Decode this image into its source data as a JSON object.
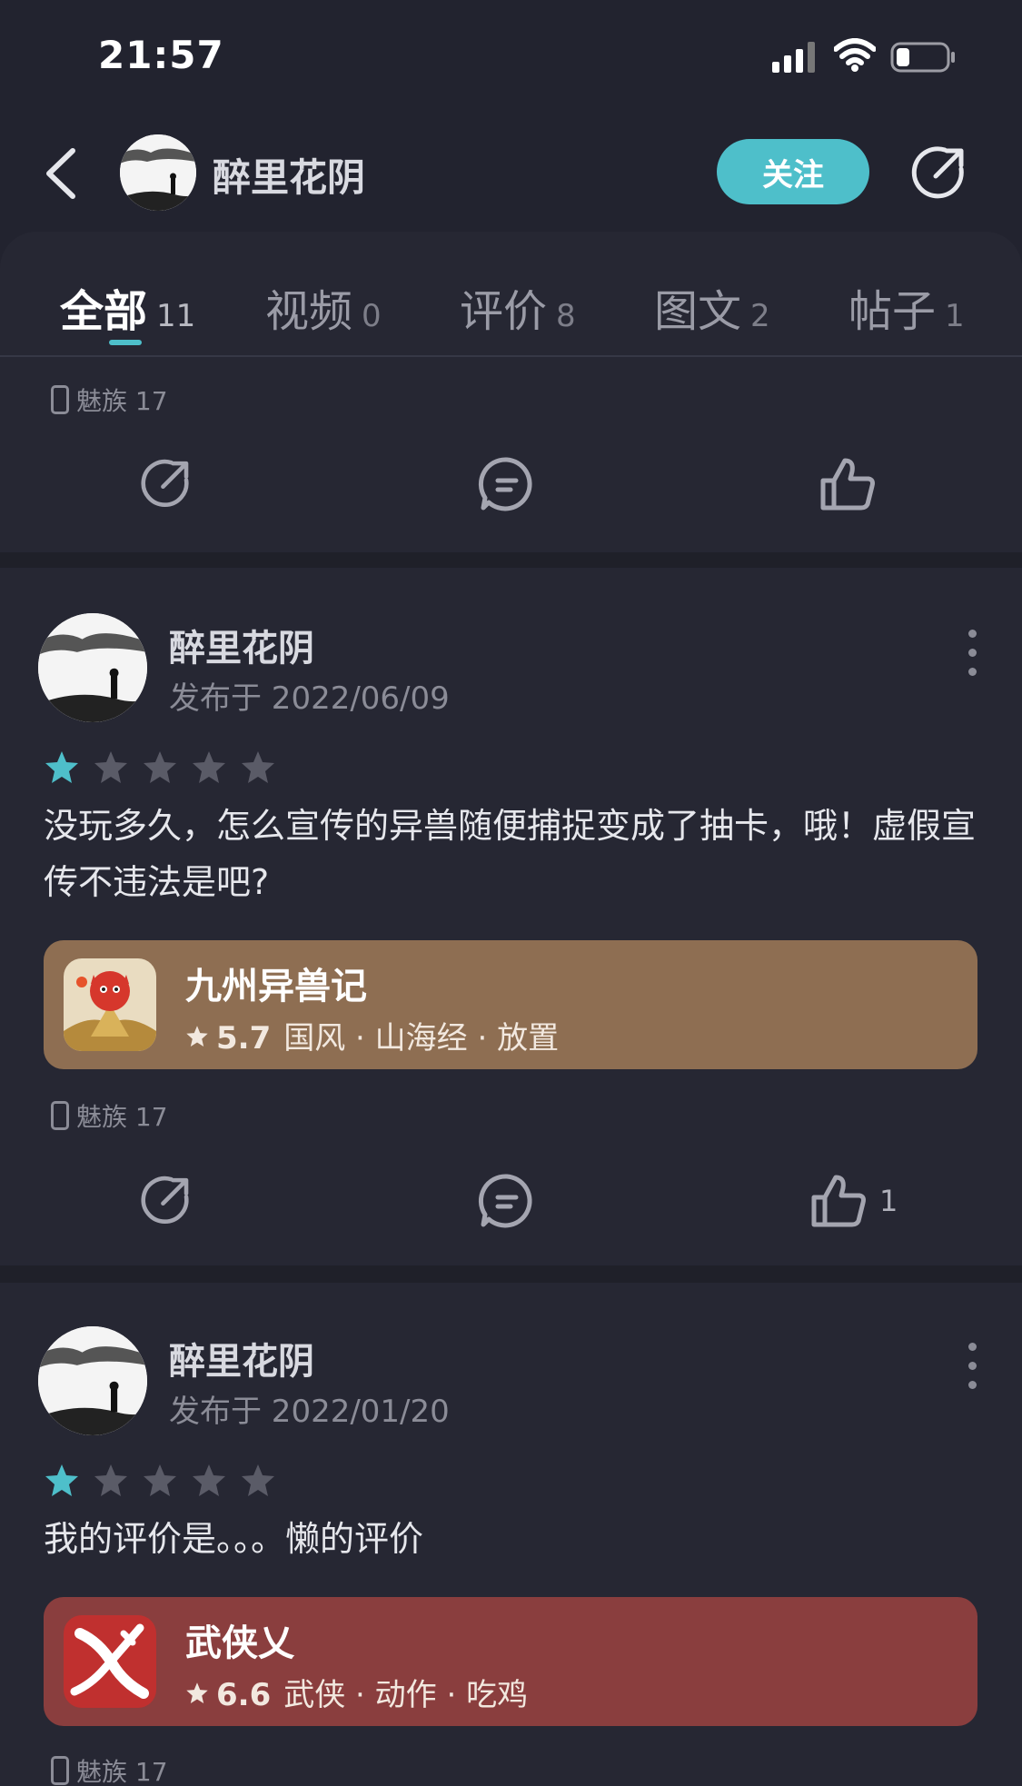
{
  "status_bar": {
    "time": "21:57"
  },
  "header": {
    "name": "醉里花阴",
    "follow_label": "关注"
  },
  "tabs": [
    {
      "label": "全部",
      "count": "11",
      "active": true
    },
    {
      "label": "视频",
      "count": "0"
    },
    {
      "label": "评价",
      "count": "8"
    },
    {
      "label": "图文",
      "count": "2"
    },
    {
      "label": "帖子",
      "count": "1"
    }
  ],
  "top_card": {
    "device": "魅族 17"
  },
  "reviews": [
    {
      "author": "醉里花阴",
      "date": "发布于 2022/06/09",
      "rating": 1,
      "rating_max": 5,
      "text": "没玩多久，怎么宣传的异兽随便捕捉变成了抽卡，哦！虚假宣传不违法是吧?",
      "game": {
        "name": "九州异兽记",
        "score": "5.7",
        "tags": "国风 · 山海经 · 放置",
        "card_color": "#8e6e52"
      },
      "device": "魅族 17",
      "likes": "1"
    },
    {
      "author": "醉里花阴",
      "date": "发布于 2022/01/20",
      "rating": 1,
      "rating_max": 5,
      "text": "我的评价是。。。懒的评价",
      "game": {
        "name": "武侠乂",
        "score": "6.6",
        "tags": "武侠 · 动作 · 吃鸡",
        "card_color": "#8a3e3e"
      },
      "device": "魅族 17"
    }
  ],
  "colors": {
    "accent": "#4ebfca",
    "background": "#22232f",
    "card": "#262733"
  }
}
